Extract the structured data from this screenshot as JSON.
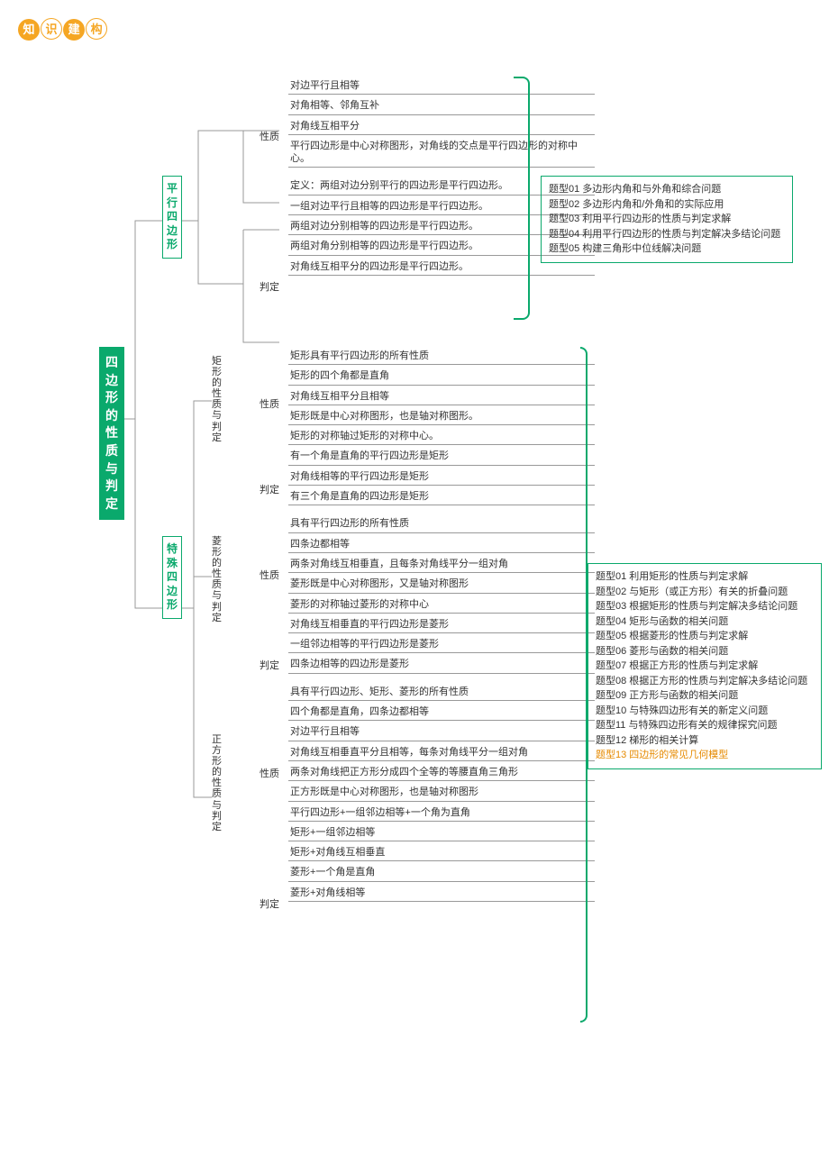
{
  "logo": [
    "知",
    "识",
    "建",
    "构"
  ],
  "root": "四边形的性质与判定",
  "level1": {
    "top": "平行四边形",
    "bot": "特殊四边形"
  },
  "section1": {
    "g1_label": "性质",
    "g1_items": [
      "对边平行且相等",
      "对角相等、邻角互补",
      "对角线互相平分",
      "平行四边形是中心对称图形，对角线的交点是平行四边形的对称中心。"
    ],
    "g2_label": "判定",
    "g2_items": [
      "定义：两组对边分别平行的四边形是平行四边形。",
      "一组对边平行且相等的四边形是平行四边形。",
      "两组对边分别相等的四边形是平行四边形。",
      "两组对角分别相等的四边形是平行四边形。",
      "对角线互相平分的四边形是平行四边形。"
    ]
  },
  "section2": {
    "sub1_label": "矩形的性质与判定",
    "sub1_g1_label": "性质",
    "sub1_g1_items": [
      "矩形具有平行四边形的所有性质",
      "矩形的四个角都是直角",
      "对角线互相平分且相等",
      "矩形既是中心对称图形，也是轴对称图形。",
      "矩形的对称轴过矩形的对称中心。"
    ],
    "sub1_g2_label": "判定",
    "sub1_g2_items": [
      "有一个角是直角的平行四边形是矩形",
      "对角线相等的平行四边形是矩形",
      "有三个角是直角的四边形是矩形"
    ],
    "sub2_label": "菱形的性质与判定",
    "sub2_g1_label": "性质",
    "sub2_g1_items": [
      "具有平行四边形的所有性质",
      "四条边都相等",
      "两条对角线互相垂直，且每条对角线平分一组对角",
      "菱形既是中心对称图形，又是轴对称图形",
      "菱形的对称轴过菱形的对称中心"
    ],
    "sub2_g2_label": "判定",
    "sub2_g2_items": [
      "对角线互相垂直的平行四边形是菱形",
      "一组邻边相等的平行四边形是菱形",
      "四条边相等的四边形是菱形"
    ],
    "sub3_label": "正方形的性质与判定",
    "sub3_g1_label": "性质",
    "sub3_g1_items": [
      "具有平行四边形、矩形、菱形的所有性质",
      "四个角都是直角，四条边都相等",
      "对边平行且相等",
      "对角线互相垂直平分且相等，每条对角线平分一组对角",
      "两条对角线把正方形分成四个全等的等腰直角三角形",
      "正方形既是中心对称图形，也是轴对称图形"
    ],
    "sub3_g2_label": "判定",
    "sub3_g2_items": [
      "平行四边形+一组邻边相等+一个角为直角",
      "矩形+一组邻边相等",
      "矩形+对角线互相垂直",
      "菱形+一个角是直角",
      "菱形+对角线相等"
    ]
  },
  "topics1": [
    "题型01 多边形内角和与外角和综合问题",
    "题型02 多边形内角和/外角和的实际应用",
    "题型03 利用平行四边形的性质与判定求解",
    "题型04 利用平行四边形的性质与判定解决多结论问题",
    "题型05 构建三角形中位线解决问题"
  ],
  "topics2": [
    {
      "t": "题型01 利用矩形的性质与判定求解",
      "hl": false
    },
    {
      "t": "题型02 与矩形（或正方形）有关的折叠问题",
      "hl": false
    },
    {
      "t": "题型03 根据矩形的性质与判定解决多结论问题",
      "hl": false
    },
    {
      "t": "题型04 矩形与函数的相关问题",
      "hl": false
    },
    {
      "t": "题型05 根据菱形的性质与判定求解",
      "hl": false
    },
    {
      "t": "题型06 菱形与函数的相关问题",
      "hl": false
    },
    {
      "t": "题型07 根据正方形的性质与判定求解",
      "hl": false
    },
    {
      "t": "题型08 根据正方形的性质与判定解决多结论问题",
      "hl": false
    },
    {
      "t": "题型09 正方形与函数的相关问题",
      "hl": false
    },
    {
      "t": "题型10 与特殊四边形有关的新定义问题",
      "hl": false
    },
    {
      "t": "题型11 与特殊四边形有关的规律探究问题",
      "hl": false
    },
    {
      "t": "题型12 梯形的相关计算",
      "hl": false
    },
    {
      "t": "题型13 四边形的常见几何模型",
      "hl": true
    }
  ]
}
